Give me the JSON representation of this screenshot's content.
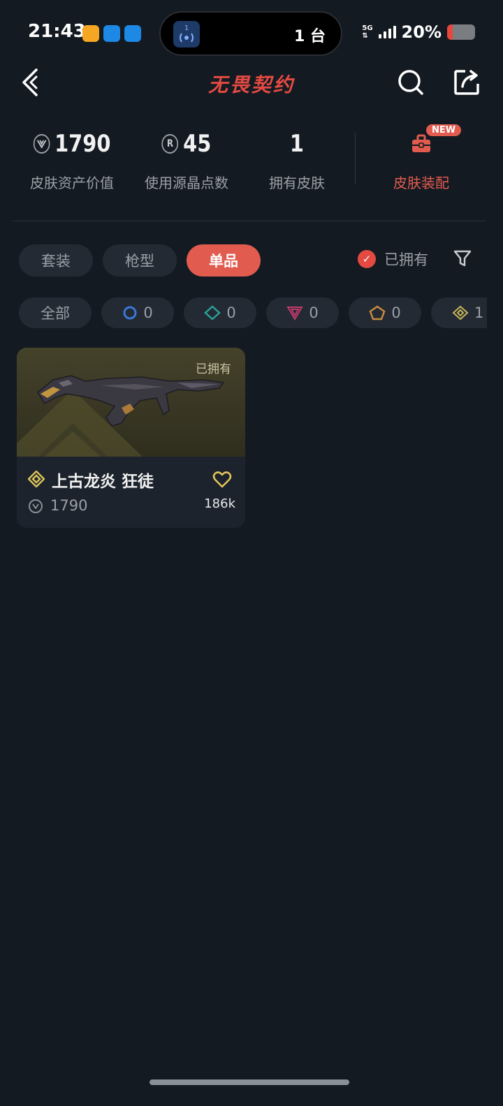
{
  "status_bar": {
    "time": "21:43",
    "island_text": "1 台",
    "island_badge": "1",
    "network": "5G",
    "battery_percent_text": "20%",
    "battery_level": 0.2,
    "battery_color": "#e8473d",
    "app_icon_colors": [
      "#f5a623",
      "#1e88e5",
      "#1e88e5"
    ]
  },
  "header": {
    "title": "无畏契约",
    "back_icon": "chevron-left-icon",
    "search_icon": "search-icon",
    "share_icon": "share-icon"
  },
  "stats": [
    {
      "value": "1790",
      "label": "皮肤资产价值",
      "icon": "vp-icon"
    },
    {
      "value": "45",
      "label": "使用源晶点数",
      "icon": "radianite-icon",
      "icon_glyph": "R"
    },
    {
      "value": "1",
      "label": "拥有皮肤"
    }
  ],
  "equip": {
    "label": "皮肤装配",
    "badge": "NEW",
    "icon": "toolbox-icon"
  },
  "tabs": [
    {
      "label": "套装",
      "active": false
    },
    {
      "label": "枪型",
      "active": false
    },
    {
      "label": "单品",
      "active": true
    }
  ],
  "owned_filter": {
    "label": "已拥有",
    "checked": true,
    "check_glyph": "✓"
  },
  "tier_chips": [
    {
      "label": "全部"
    },
    {
      "count": "0",
      "tier": "select",
      "color": "#3a78d8"
    },
    {
      "count": "0",
      "tier": "deluxe",
      "color": "#2aa198"
    },
    {
      "count": "0",
      "tier": "premium",
      "color": "#c0396b"
    },
    {
      "count": "0",
      "tier": "ultra",
      "color": "#c78a3f"
    },
    {
      "count": "1",
      "tier": "exclusive",
      "color": "#c8b45a"
    }
  ],
  "items": [
    {
      "name": "上古龙炎 狂徒",
      "owned_tag": "已拥有",
      "price": "1790",
      "likes": "186k",
      "tier_color": "#d8c25a"
    }
  ],
  "colors": {
    "accent": "#e25b4f",
    "background": "#141a22",
    "card": "#1c232c"
  }
}
